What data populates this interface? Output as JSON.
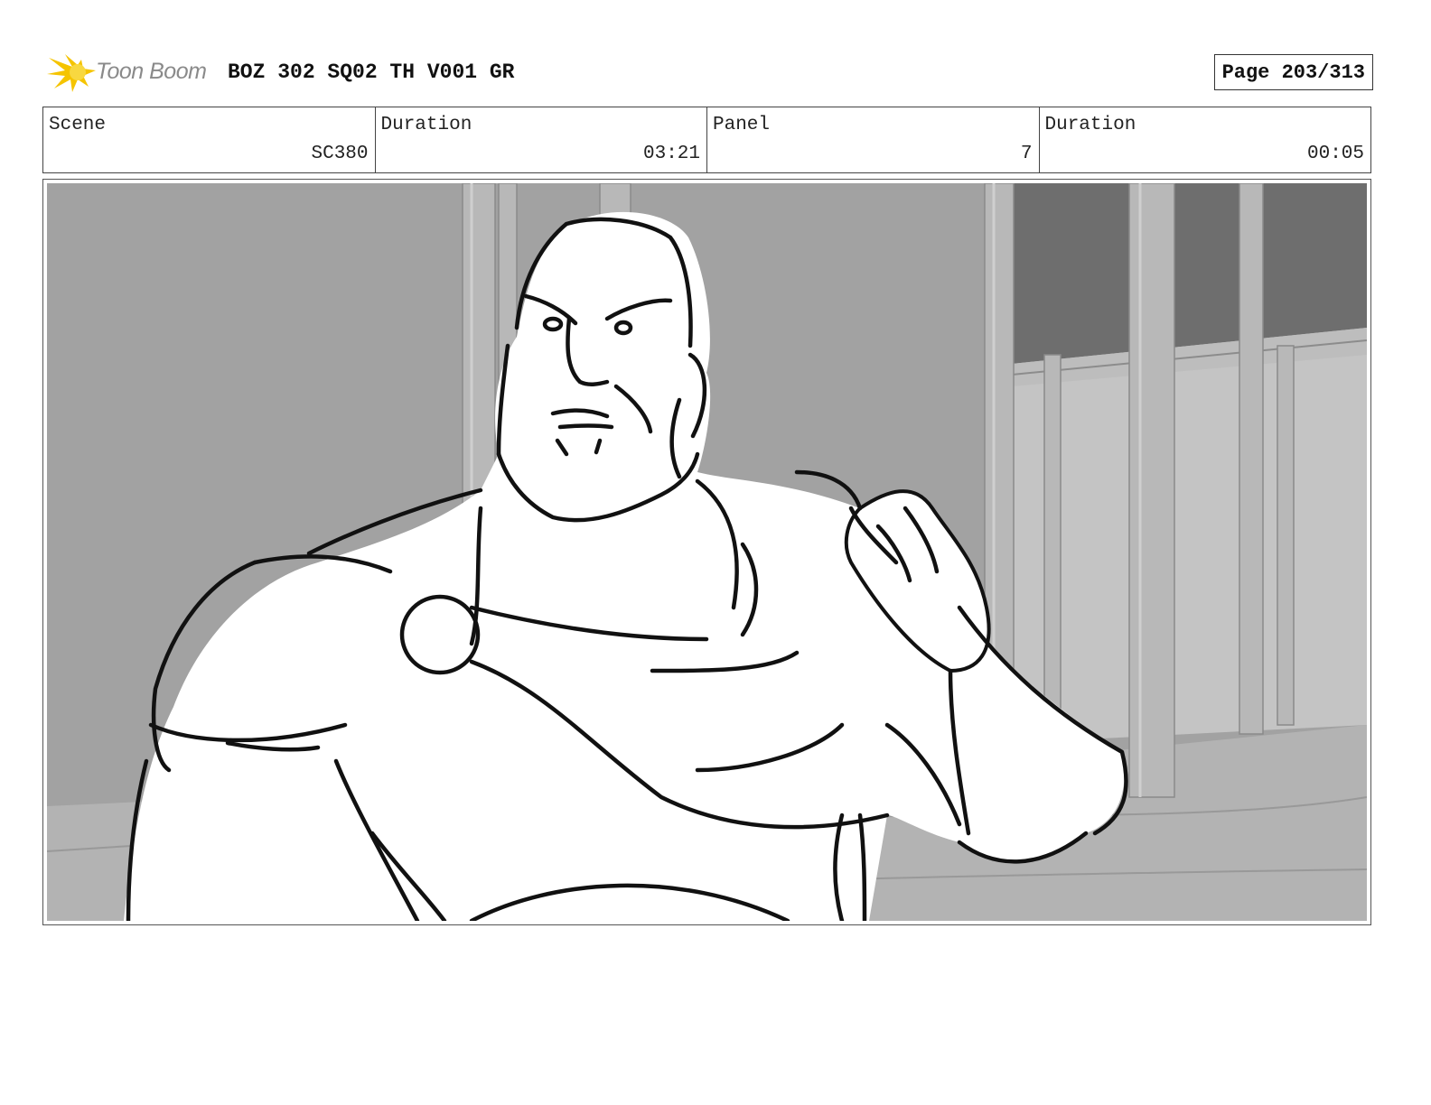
{
  "header": {
    "logo_text": "Toon Boom",
    "title": "BOZ 302 SQ02 TH V001 GR",
    "page": "Page 203/313"
  },
  "info": {
    "scene_label": "Scene",
    "scene_value": "SC380",
    "duration_label": "Duration",
    "duration_value": "03:21",
    "panel_label": "Panel",
    "panel_value": "7",
    "panel_duration_label": "Duration",
    "panel_duration_value": "00:05"
  },
  "colors": {
    "logo_accent": "#f5c400",
    "background_gray": "#9e9e9e",
    "sketch_line": "#111111"
  }
}
